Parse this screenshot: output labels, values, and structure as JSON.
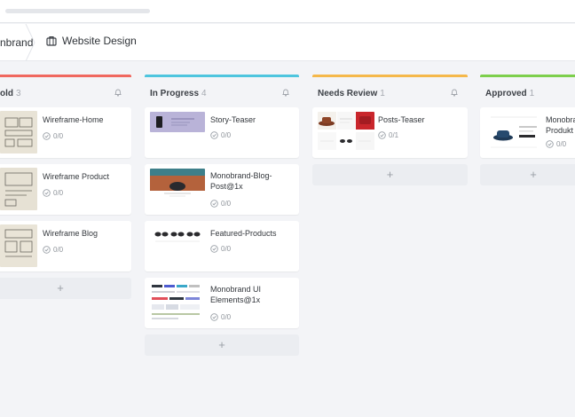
{
  "breadcrumb": {
    "brand": "nbrand",
    "project": "Website Design"
  },
  "columns": [
    {
      "title": "old",
      "count": "3",
      "color": "#f0685f",
      "cards": [
        {
          "title": "Wireframe-Home",
          "meta": "0/0"
        },
        {
          "title": "Wireframe Product",
          "meta": "0/0"
        },
        {
          "title": "Wireframe Blog",
          "meta": "0/0"
        }
      ]
    },
    {
      "title": "In Progress",
      "count": "4",
      "color": "#4ec5de",
      "cards": [
        {
          "title": "Story-Teaser",
          "meta": "0/0"
        },
        {
          "title": "Monobrand-Blog-Post@1x",
          "meta": "0/0"
        },
        {
          "title": "Featured-Products",
          "meta": "0/0"
        },
        {
          "title": "Monobrand UI Elements@1x",
          "meta": "0/0"
        }
      ]
    },
    {
      "title": "Needs Review",
      "count": "1",
      "color": "#f5b84a",
      "cards": [
        {
          "title": "Posts-Teaser",
          "meta": "0/1"
        }
      ]
    },
    {
      "title": "Approved",
      "count": "1",
      "color": "#7dcf4c",
      "cards": [
        {
          "title": "Monobra Produkt",
          "meta": "0/0"
        }
      ]
    }
  ],
  "add_label": "+"
}
